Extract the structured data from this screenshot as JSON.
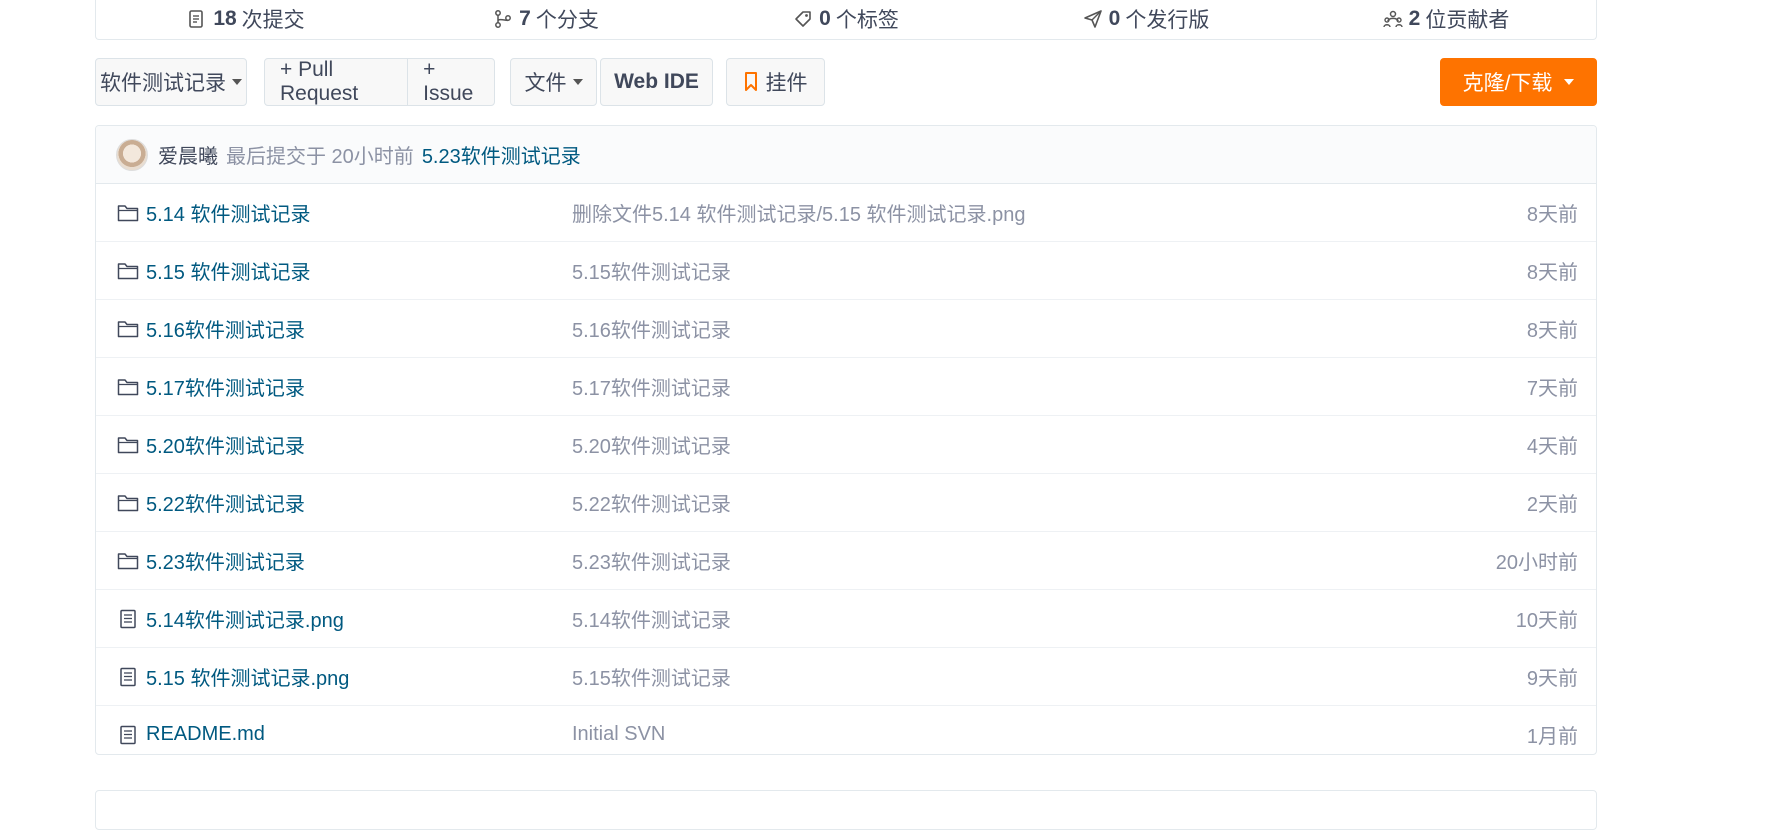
{
  "stats": [
    {
      "icon": "commit-icon",
      "num": "18",
      "label": "次提交"
    },
    {
      "icon": "branch-icon",
      "num": "7",
      "label": "个分支"
    },
    {
      "icon": "tag-icon",
      "num": "0",
      "label": "个标签"
    },
    {
      "icon": "release-icon",
      "num": "0",
      "label": "个发行版"
    },
    {
      "icon": "contributors-icon",
      "num": "2",
      "label": "位贡献者"
    }
  ],
  "toolbar": {
    "branch_label": "软件测试记录",
    "pull_request_label": "+ Pull Request",
    "issue_label": "+ Issue",
    "file_label": "文件",
    "web_ide_label": "Web IDE",
    "widget_label": "挂件",
    "clone_label": "克隆/下载"
  },
  "latest_commit": {
    "author": "爱晨曦",
    "meta": "最后提交于 20小时前",
    "message": "5.23软件测试记录"
  },
  "files": [
    {
      "type": "folder",
      "name": "5.14 软件测试记录",
      "message": "删除文件5.14 软件测试记录/5.15 软件测试记录.png",
      "age": "8天前"
    },
    {
      "type": "folder",
      "name": "5.15 软件测试记录",
      "message": "5.15软件测试记录",
      "age": "8天前"
    },
    {
      "type": "folder",
      "name": "5.16软件测试记录",
      "message": "5.16软件测试记录",
      "age": "8天前"
    },
    {
      "type": "folder",
      "name": "5.17软件测试记录",
      "message": "5.17软件测试记录",
      "age": "7天前"
    },
    {
      "type": "folder",
      "name": "5.20软件测试记录",
      "message": "5.20软件测试记录",
      "age": "4天前"
    },
    {
      "type": "folder",
      "name": "5.22软件测试记录",
      "message": "5.22软件测试记录",
      "age": "2天前"
    },
    {
      "type": "folder",
      "name": "5.23软件测试记录",
      "message": "5.23软件测试记录",
      "age": "20小时前"
    },
    {
      "type": "file",
      "name": "5.14软件测试记录.png",
      "message": "5.14软件测试记录",
      "age": "10天前"
    },
    {
      "type": "file",
      "name": "5.15 软件测试记录.png",
      "message": "5.15软件测试记录",
      "age": "9天前"
    },
    {
      "type": "file",
      "name": "README.md",
      "message": "Initial SVN",
      "age": "1月前"
    }
  ],
  "colors": {
    "accent_orange": "#fe7300",
    "link_blue": "#005980",
    "muted_gray": "#8c92a4"
  }
}
